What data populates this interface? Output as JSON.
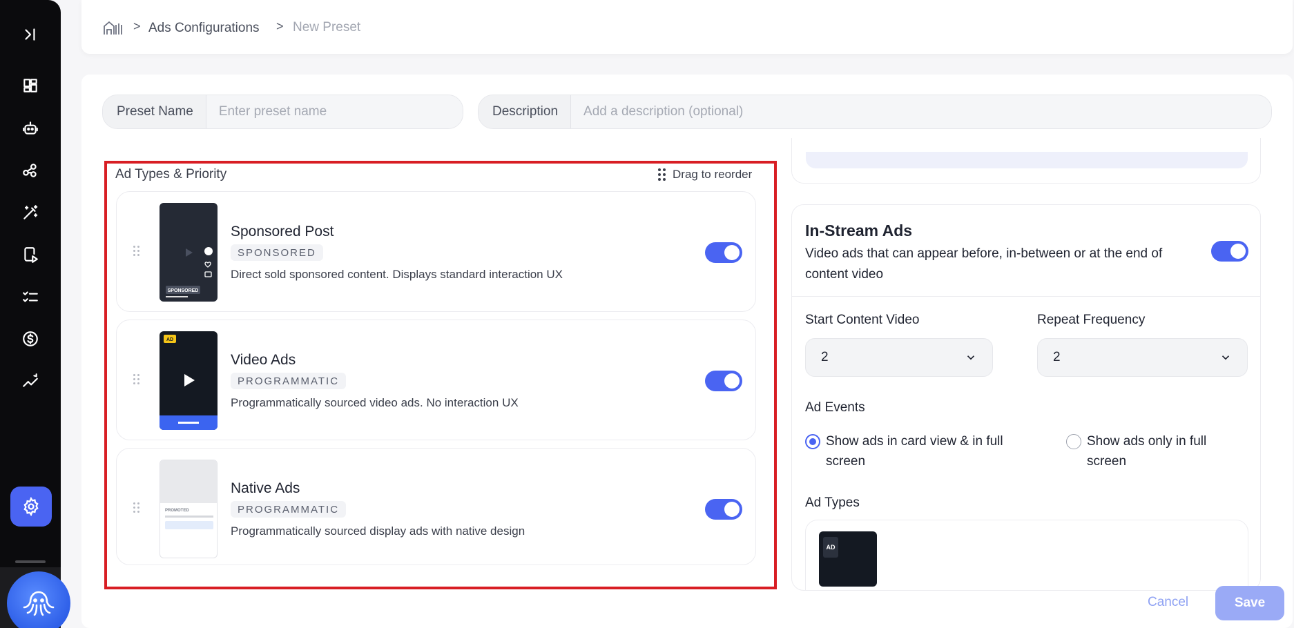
{
  "breadcrumb": {
    "home_icon": "home-icon",
    "items": [
      "Ads Configurations",
      "New Preset"
    ],
    "separator": ">"
  },
  "sidebar": {
    "items": [
      {
        "icon": "expand-sidebar-icon"
      },
      {
        "icon": "dashboard-icon"
      },
      {
        "icon": "robot-icon"
      },
      {
        "icon": "nodes-icon"
      },
      {
        "icon": "magic-wand-icon"
      },
      {
        "icon": "mobile-play-icon"
      },
      {
        "icon": "checklist-icon"
      },
      {
        "icon": "dollar-icon"
      },
      {
        "icon": "analytics-icon"
      },
      {
        "icon": "gear-icon",
        "active": true
      }
    ],
    "active_color": "#4a64f2"
  },
  "form": {
    "preset_name": {
      "label": "Preset Name",
      "placeholder": "Enter preset name",
      "value": ""
    },
    "description": {
      "label": "Description",
      "placeholder": "Add a description (optional)",
      "value": ""
    }
  },
  "ad_types": {
    "title": "Ad Types & Priority",
    "drag_hint": "Drag to reorder",
    "items": [
      {
        "name": "Sponsored Post",
        "badge": "SPONSORED",
        "description": "Direct sold sponsored content. Displays standard interaction UX",
        "enabled": true,
        "thumb_label": "SPONSORED"
      },
      {
        "name": "Video Ads",
        "badge": "PROGRAMMATIC",
        "description": "Programmatically sourced video ads. No interaction UX",
        "enabled": true,
        "thumb_label": "AD"
      },
      {
        "name": "Native Ads",
        "badge": "PROGRAMMATIC",
        "description": "Programmatically sourced display ads with native design",
        "enabled": true,
        "thumb_label": "PROMOTED"
      }
    ]
  },
  "in_stream": {
    "title": "In-Stream Ads",
    "description": "Video ads that can appear before, in-between or at the end of content video",
    "enabled": true,
    "start_content_video": {
      "label": "Start Content Video",
      "value": "2"
    },
    "repeat_frequency": {
      "label": "Repeat Frequency",
      "value": "2"
    },
    "ad_events": {
      "label": "Ad Events",
      "options": [
        "Show ads in card view & in full screen",
        "Show ads only in full screen"
      ],
      "selected": 0
    },
    "ad_types_label": "Ad Types",
    "ad_types_thumb_label": "AD"
  },
  "actions": {
    "cancel": "Cancel",
    "save": "Save"
  },
  "colors": {
    "accent": "#4a64f2",
    "highlight": "#d81e24"
  }
}
